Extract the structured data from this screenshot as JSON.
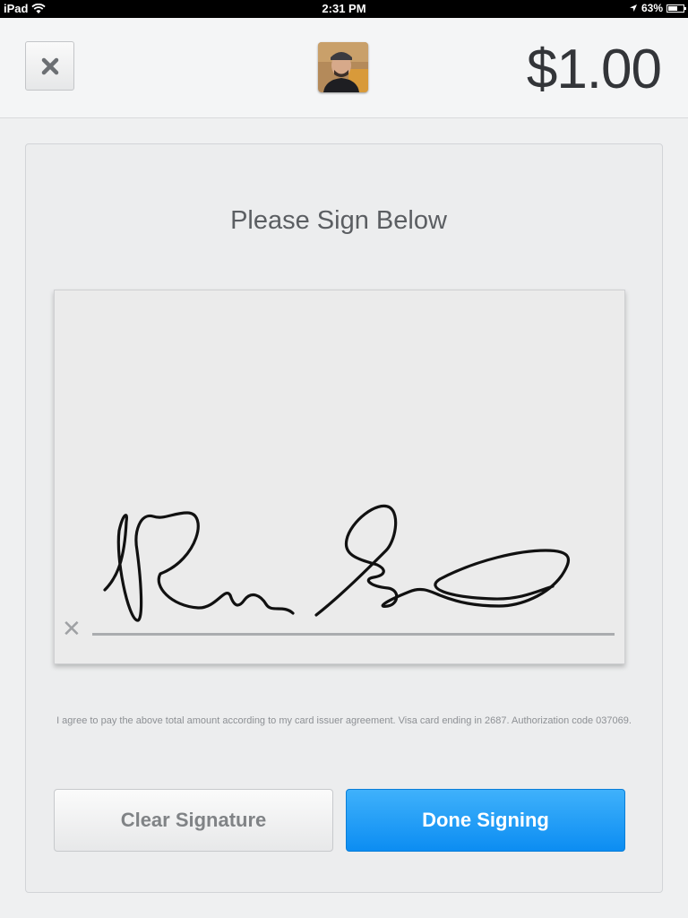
{
  "status_bar": {
    "device": "iPad",
    "time": "2:31 PM",
    "battery_percent": "63%",
    "battery_level": 0.63
  },
  "header": {
    "amount": "$1.00",
    "close_icon": "close-x-icon",
    "avatar_icon": "customer-avatar"
  },
  "signature": {
    "title": "Please Sign Below",
    "clear_mark": "✕"
  },
  "agreement": {
    "text": "I agree to pay the above total amount according to my card issuer agreement. Visa card ending in 2687. Authorization code 037069."
  },
  "buttons": {
    "clear_label": "Clear Signature",
    "done_label": "Done Signing"
  },
  "colors": {
    "accent": "#1a9af6",
    "background": "#eff0f1"
  }
}
